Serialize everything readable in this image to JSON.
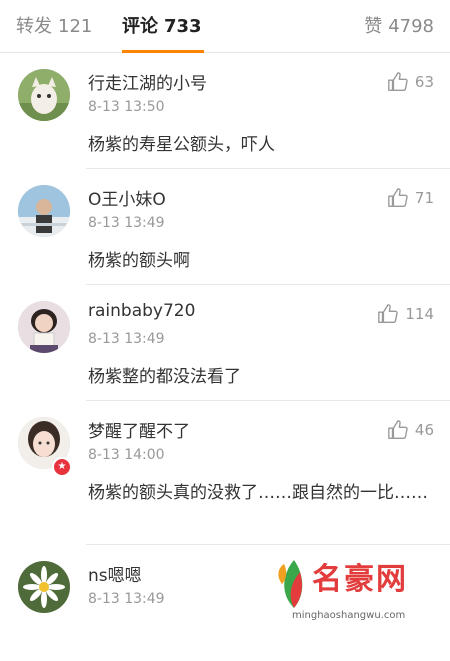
{
  "tabs": {
    "repost": {
      "label": "转发",
      "count": "121"
    },
    "comment": {
      "label": "评论",
      "count": "733"
    },
    "like": {
      "label": "赞",
      "count": "4798"
    }
  },
  "comments": [
    {
      "username": "行走江湖的小号",
      "time": "8-13 13:50",
      "text": "杨紫的寿星公额头，吓人",
      "likes": "63"
    },
    {
      "username": "O王小妹O",
      "time": "8-13 13:49",
      "text": "杨紫的额头啊",
      "likes": "71"
    },
    {
      "username": "rainbaby720",
      "time": "8-13 13:49",
      "text": "杨紫整的都没法看了",
      "likes": "114"
    },
    {
      "username": "梦醒了醒不了",
      "time": "8-13 14:00",
      "text": "杨紫的额头真的没救了……跟自然的一比……",
      "likes": "46"
    },
    {
      "username": "ns嗯嗯",
      "time": "8-13 13:49",
      "text": "",
      "likes": ""
    }
  ],
  "watermark": {
    "name": "名豪网",
    "url": "minghaoshangwu.com"
  },
  "colors": {
    "accent": "#ff8200",
    "text": "#333333",
    "muted": "#999999"
  }
}
